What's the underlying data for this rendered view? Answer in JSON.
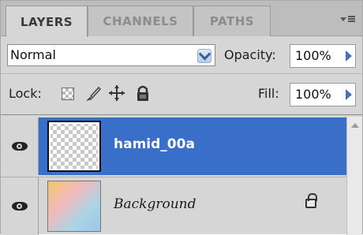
{
  "tabs": [
    {
      "label": "LAYERS",
      "active": true
    },
    {
      "label": "CHANNELS",
      "active": false
    },
    {
      "label": "PATHS",
      "active": false
    }
  ],
  "panel_menu": {
    "icon": "panel-menu-icon"
  },
  "blend": {
    "mode": "Normal",
    "opacity_label": "Opacity:",
    "opacity_value": "100%"
  },
  "lock": {
    "label": "Lock:",
    "icons": [
      "lock-transparent-icon",
      "lock-brush-icon",
      "lock-move-icon",
      "lock-all-icon"
    ],
    "fill_label": "Fill:",
    "fill_value": "100%"
  },
  "layers": [
    {
      "name": "hamid_00a",
      "selected": true,
      "visible": true
    },
    {
      "name": "Background",
      "selected": false,
      "visible": true,
      "locked": true
    }
  ],
  "colors": {
    "selection": "#3a6fc9",
    "panel": "#d6d6d6",
    "accent_arrow": "#4a70b3"
  }
}
